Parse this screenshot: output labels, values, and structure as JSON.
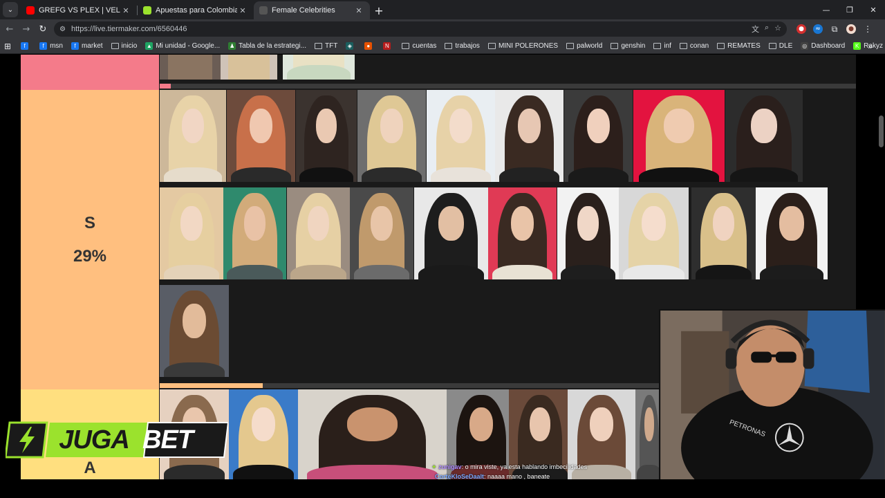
{
  "browser": {
    "tabs": [
      {
        "title": "GREFG VS PLEX | VELADA DEL A",
        "favicon_color": "#ff0000",
        "active": false
      },
      {
        "title": "Apuestas para Colombia vs Fra",
        "favicon_color": "#9be22d",
        "active": false
      },
      {
        "title": "Female Celebrities",
        "favicon_color": "#555555",
        "active": true
      }
    ],
    "new_tab_symbol": "+",
    "url": "https://live.tiermaker.com/6560446"
  },
  "bookmarks": [
    {
      "label": "",
      "type": "site",
      "color": "#1877f2",
      "icon": "f"
    },
    {
      "label": "msn",
      "type": "site",
      "color": "#1877f2",
      "icon": "f"
    },
    {
      "label": "market",
      "type": "site",
      "color": "#1877f2",
      "icon": "f"
    },
    {
      "label": "inicio",
      "type": "folder"
    },
    {
      "label": "Mi unidad - Google...",
      "type": "site",
      "color": "#1fa463",
      "icon": "▲"
    },
    {
      "label": "Tabla de la estrategi...",
      "type": "site",
      "color": "#2e7d32",
      "icon": "♟"
    },
    {
      "label": "TFT",
      "type": "folder"
    },
    {
      "label": "",
      "type": "site",
      "color": "#1b5e5e",
      "icon": "◈"
    },
    {
      "label": "",
      "type": "site",
      "color": "#e65100",
      "icon": "●"
    },
    {
      "label": "",
      "type": "site",
      "color": "#b71c1c",
      "icon": "N"
    },
    {
      "label": "cuentas",
      "type": "folder"
    },
    {
      "label": "trabajos",
      "type": "folder"
    },
    {
      "label": "MINI POLERONES",
      "type": "folder"
    },
    {
      "label": "palworld",
      "type": "folder"
    },
    {
      "label": "genshin",
      "type": "folder"
    },
    {
      "label": "inf",
      "type": "folder"
    },
    {
      "label": "conan",
      "type": "folder"
    },
    {
      "label": "REMATES",
      "type": "folder"
    },
    {
      "label": "DLE",
      "type": "folder"
    },
    {
      "label": "Dashboard",
      "type": "site",
      "color": "#424242",
      "icon": "◎"
    },
    {
      "label": "Rakyz Stream - Wat...",
      "type": "site",
      "color": "#53fc18",
      "icon": "K"
    }
  ],
  "tiers": {
    "top": {
      "color": "#f47b8a"
    },
    "s": {
      "label": "S",
      "percent": "29%",
      "color": "#ffbf7f"
    },
    "a": {
      "label": "A",
      "color": "#ffdf7f"
    }
  },
  "overlay": {
    "brand_left": "JUGA",
    "brand_right": "BET",
    "chat": [
      {
        "user": "zunigav",
        "message": ": o mira viste, ya esta hablando imbecilidades"
      },
      {
        "user": "CorteKloSeDaalt",
        "message": ": naaaa mano , baneate"
      }
    ]
  }
}
